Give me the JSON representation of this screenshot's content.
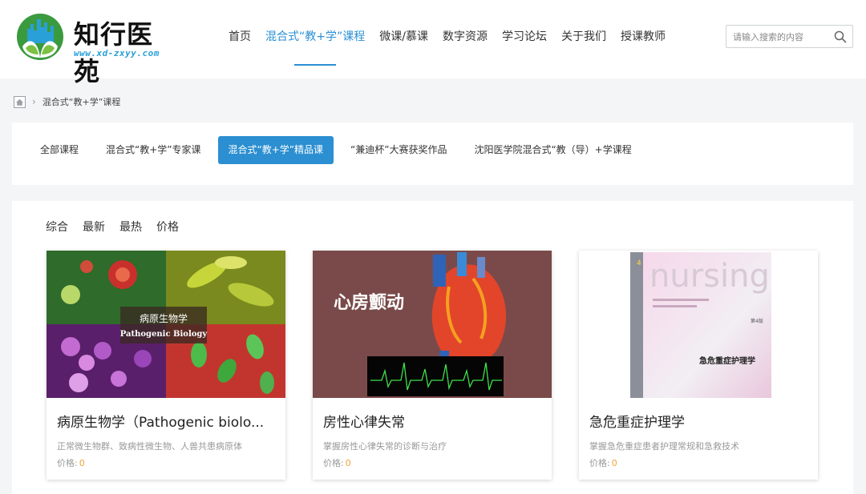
{
  "header": {
    "logo_title": "知行医苑",
    "logo_url": "www.xd-zxyy.com",
    "nav": [
      {
        "label": "首页",
        "active": false
      },
      {
        "label": "混合式“教+学”课程",
        "active": true
      },
      {
        "label": "微课/慕课",
        "active": false
      },
      {
        "label": "数字资源",
        "active": false
      },
      {
        "label": "学习论坛",
        "active": false
      },
      {
        "label": "关于我们",
        "active": false
      },
      {
        "label": "授课教师",
        "active": false
      }
    ],
    "search": {
      "placeholder": "请输入搜索的内容",
      "value": ""
    }
  },
  "breadcrumb": {
    "current": "混合式“教+学”课程"
  },
  "filter_tabs": [
    {
      "label": "全部课程",
      "active": false
    },
    {
      "label": "混合式“教+学”专家课",
      "active": false
    },
    {
      "label": "混合式“教+学”精品课",
      "active": true
    },
    {
      "label": "“兼迪杯”大赛获奖作品",
      "active": false
    },
    {
      "label": "沈阳医学院混合式“教（导）+学课程",
      "active": false
    }
  ],
  "sort": [
    "综合",
    "最新",
    "最热",
    "价格"
  ],
  "price_label": "价格:",
  "courses": [
    {
      "title": "病原生物学（Pathogenic biolo...",
      "desc": "正常微生物群、致病性微生物、人兽共患病原体",
      "price": "0",
      "thumb_caption_cn": "病原生物学",
      "thumb_caption_en": "Pathogenic Biology"
    },
    {
      "title": "房性心律失常",
      "desc": "掌握房性心律失常的诊断与治疗",
      "price": "0",
      "thumb_caption_cn": "心房颤动"
    },
    {
      "title": "急危重症护理学",
      "desc": "掌握急危重症患者护理常规和急救技术",
      "price": "0",
      "thumb_book_word": "nursing",
      "thumb_book_edition": "第4版",
      "thumb_book_title": "急危重症护理学",
      "thumb_spine_num": "4"
    }
  ],
  "colors": {
    "accent": "#2b8fd1",
    "price": "#f0a23c",
    "logo_green": "#3a9a3e",
    "logo_blue": "#2aa0d8"
  }
}
